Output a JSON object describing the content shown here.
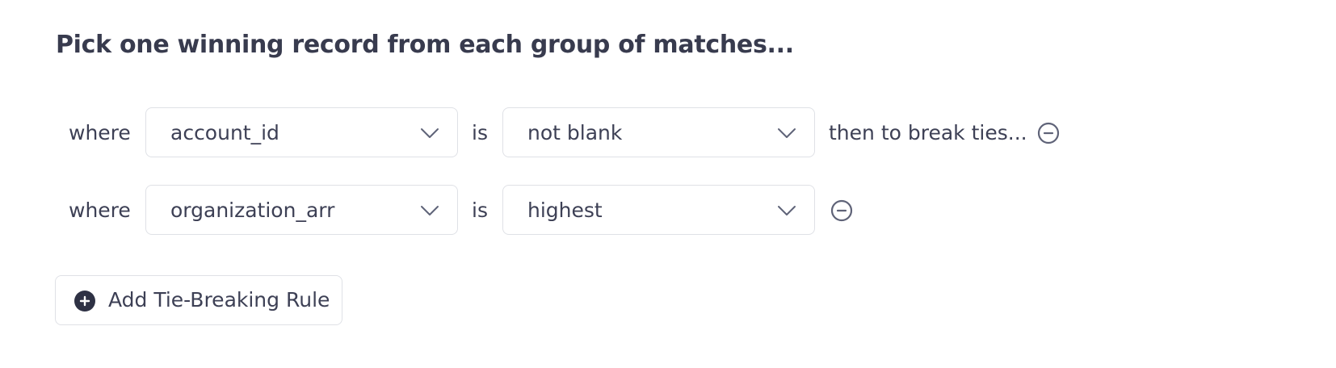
{
  "header": {
    "title": "Pick one winning record from each group of matches..."
  },
  "rules": [
    {
      "prefix": "where",
      "field": "account_id",
      "connector": "is",
      "operator": "not blank",
      "suffix": "then to break ties..."
    },
    {
      "prefix": "where",
      "field": "organization_arr",
      "connector": "is",
      "operator": "highest"
    }
  ],
  "add_rule": {
    "label": "Add Tie-Breaking Rule"
  },
  "icons": {
    "dropdown": "chevron-down-icon",
    "remove": "minus-circle-icon",
    "add": "plus-circle-icon"
  },
  "colors": {
    "text": "#3d4055",
    "heading": "#383b4e",
    "border": "#dfe1e6",
    "icon": "#5f6378",
    "add_icon_fill": "#2e3144"
  }
}
